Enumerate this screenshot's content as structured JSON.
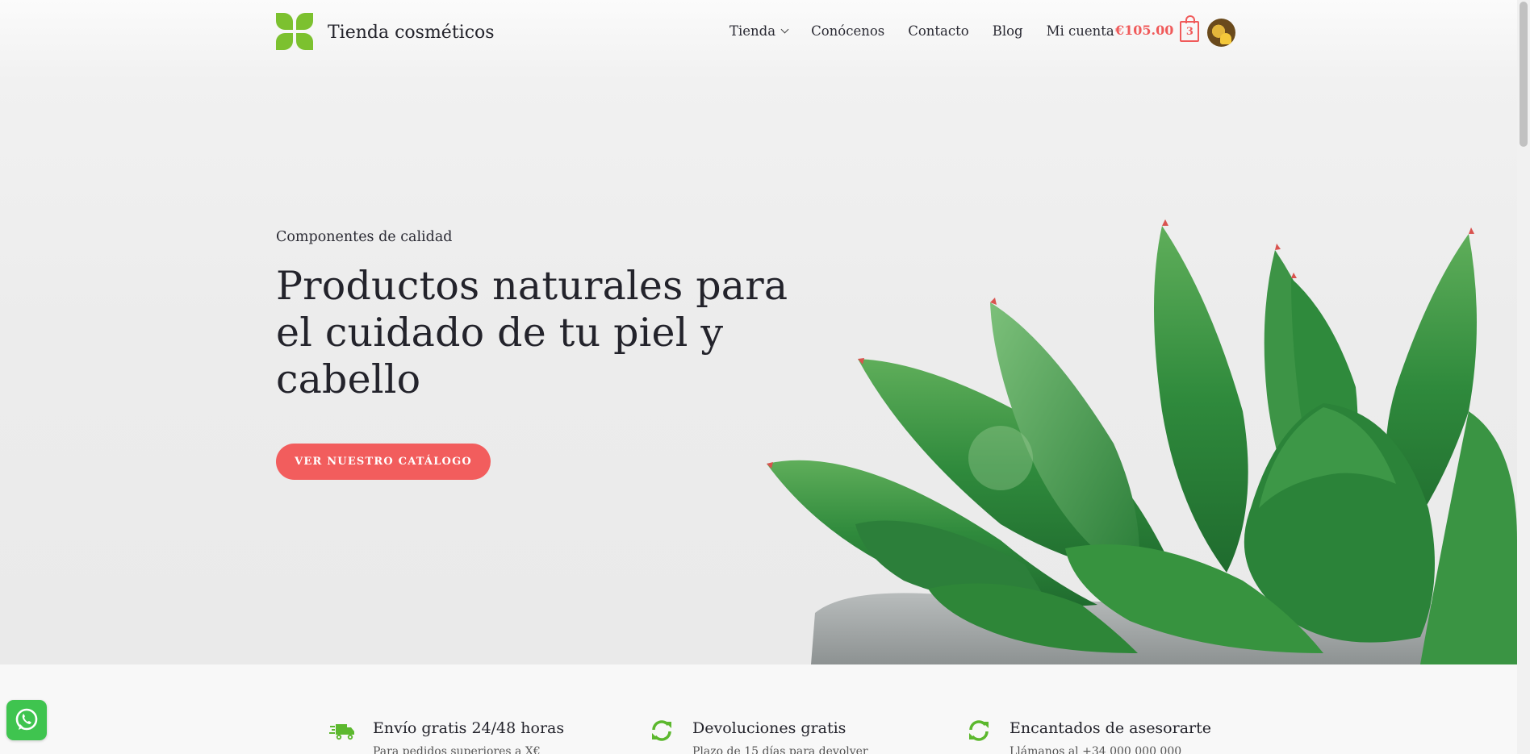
{
  "site": {
    "title": "Tienda cosméticos"
  },
  "nav": {
    "items": [
      {
        "label": "Tienda",
        "has_dropdown": true
      },
      {
        "label": "Conócenos"
      },
      {
        "label": "Contacto"
      },
      {
        "label": "Blog"
      },
      {
        "label": "Mi cuenta"
      }
    ],
    "cart": {
      "total": "€105.00",
      "count": "3"
    }
  },
  "hero": {
    "kicker": "Componentes de calidad",
    "headline": "Productos naturales para el cuidado de tu piel y cabello",
    "cta_label": "Ver nuestro catálogo"
  },
  "features": [
    {
      "icon": "truck-icon",
      "title": "Envío gratis 24/48 horas",
      "subtitle": "Para pedidos superiores a X€"
    },
    {
      "icon": "refresh-icon",
      "title": "Devoluciones gratis",
      "subtitle": "Plazo de 15 días para devolver"
    },
    {
      "icon": "refresh-icon",
      "title": "Encantados de asesorarte",
      "subtitle": "Llámanos al +34 000 000 000"
    }
  ],
  "colors": {
    "accent": "#f25d5d",
    "brand_green": "#7cc12f",
    "icon_green": "#5cb82e",
    "whatsapp": "#3fc44f"
  }
}
